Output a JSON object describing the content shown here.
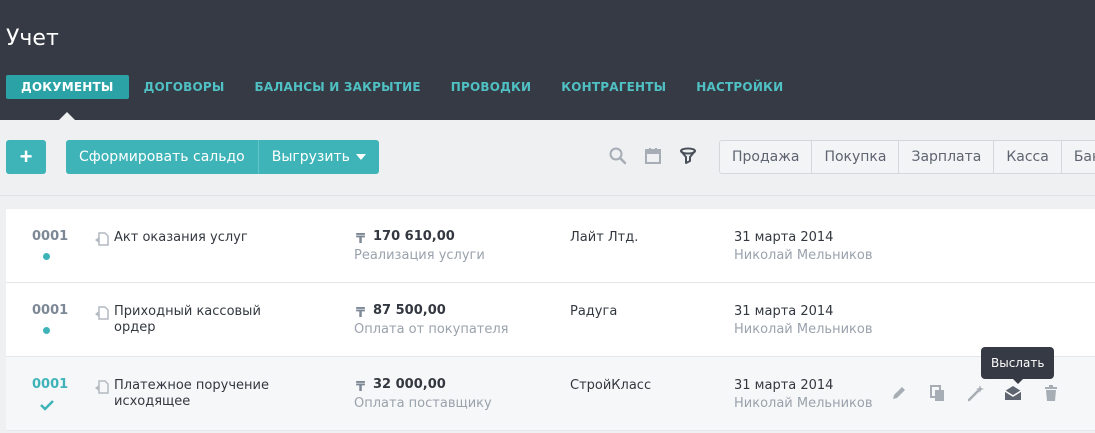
{
  "header": {
    "title": "Учет",
    "tabs": [
      {
        "label": "ДОКУМЕНТЫ",
        "active": true
      },
      {
        "label": "ДОГОВОРЫ",
        "active": false
      },
      {
        "label": "БАЛАНСЫ И ЗАКРЫТИЕ",
        "active": false
      },
      {
        "label": "ПРОВОДКИ",
        "active": false
      },
      {
        "label": "КОНТРАГЕНТЫ",
        "active": false
      },
      {
        "label": "НАСТРОЙКИ",
        "active": false
      }
    ]
  },
  "toolbar": {
    "add_label": "+",
    "form_balance_label": "Сформировать сальдо",
    "export_label": "Выгрузить",
    "icons": [
      "search-icon",
      "calendar-icon",
      "filter-icon"
    ],
    "filters": [
      "Продажа",
      "Покупка",
      "Зарплата",
      "Касса",
      "Банк"
    ]
  },
  "rows": [
    {
      "num": "0001",
      "status": "dot",
      "name": "Акт оказания услуг",
      "currency": "₸",
      "sum": "170 610,00",
      "sum_sub": "Реализация услуги",
      "party": "Лайт Лтд.",
      "date": "31 марта 2014",
      "author": "Николай Мельников"
    },
    {
      "num": "0001",
      "status": "dot",
      "name": "Приходный кассовый ордер",
      "currency": "₸",
      "sum": "87 500,00",
      "sum_sub": "Оплата от покупателя",
      "party": "Радуга",
      "date": "31 марта 2014",
      "author": "Николай Мельников"
    },
    {
      "num": "0001",
      "status": "check",
      "name": "Платежное поручение исходящее",
      "currency": "₸",
      "sum": "32 000,00",
      "sum_sub": "Оплата поставщику",
      "party": "СтройКласс",
      "date": "31 марта 2014",
      "author": "Николай Мельников"
    }
  ],
  "row_actions": [
    "pencil-icon",
    "copy-icon",
    "wand-icon",
    "envelope-icon",
    "trash-icon"
  ],
  "tooltip": {
    "text": "Выслать"
  },
  "colors": {
    "header_bg": "#363a44",
    "accent": "#3fb4b8",
    "nav_text": "#4fc0c3",
    "active_tab": "#2ba3a6"
  }
}
